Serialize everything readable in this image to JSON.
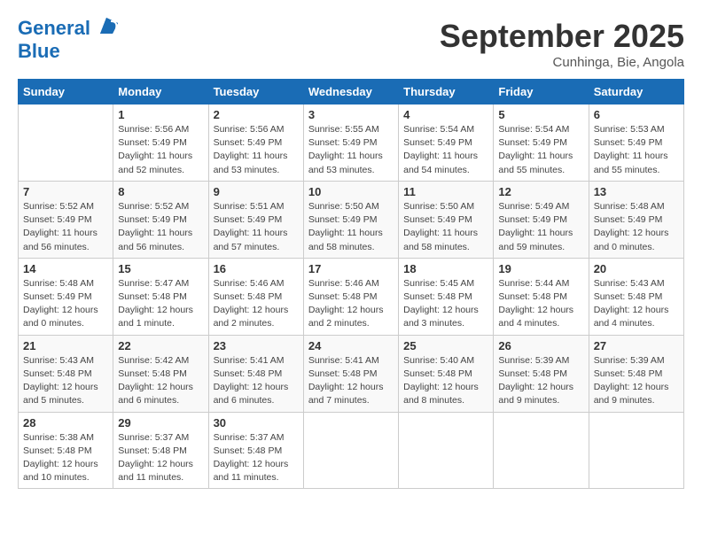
{
  "header": {
    "logo_line1": "General",
    "logo_line2": "Blue",
    "month": "September 2025",
    "location": "Cunhinga, Bie, Angola"
  },
  "days_of_week": [
    "Sunday",
    "Monday",
    "Tuesday",
    "Wednesday",
    "Thursday",
    "Friday",
    "Saturday"
  ],
  "weeks": [
    [
      {
        "day": "",
        "info": ""
      },
      {
        "day": "1",
        "info": "Sunrise: 5:56 AM\nSunset: 5:49 PM\nDaylight: 11 hours\nand 52 minutes."
      },
      {
        "day": "2",
        "info": "Sunrise: 5:56 AM\nSunset: 5:49 PM\nDaylight: 11 hours\nand 53 minutes."
      },
      {
        "day": "3",
        "info": "Sunrise: 5:55 AM\nSunset: 5:49 PM\nDaylight: 11 hours\nand 53 minutes."
      },
      {
        "day": "4",
        "info": "Sunrise: 5:54 AM\nSunset: 5:49 PM\nDaylight: 11 hours\nand 54 minutes."
      },
      {
        "day": "5",
        "info": "Sunrise: 5:54 AM\nSunset: 5:49 PM\nDaylight: 11 hours\nand 55 minutes."
      },
      {
        "day": "6",
        "info": "Sunrise: 5:53 AM\nSunset: 5:49 PM\nDaylight: 11 hours\nand 55 minutes."
      }
    ],
    [
      {
        "day": "7",
        "info": "Sunrise: 5:52 AM\nSunset: 5:49 PM\nDaylight: 11 hours\nand 56 minutes."
      },
      {
        "day": "8",
        "info": "Sunrise: 5:52 AM\nSunset: 5:49 PM\nDaylight: 11 hours\nand 56 minutes."
      },
      {
        "day": "9",
        "info": "Sunrise: 5:51 AM\nSunset: 5:49 PM\nDaylight: 11 hours\nand 57 minutes."
      },
      {
        "day": "10",
        "info": "Sunrise: 5:50 AM\nSunset: 5:49 PM\nDaylight: 11 hours\nand 58 minutes."
      },
      {
        "day": "11",
        "info": "Sunrise: 5:50 AM\nSunset: 5:49 PM\nDaylight: 11 hours\nand 58 minutes."
      },
      {
        "day": "12",
        "info": "Sunrise: 5:49 AM\nSunset: 5:49 PM\nDaylight: 11 hours\nand 59 minutes."
      },
      {
        "day": "13",
        "info": "Sunrise: 5:48 AM\nSunset: 5:49 PM\nDaylight: 12 hours\nand 0 minutes."
      }
    ],
    [
      {
        "day": "14",
        "info": "Sunrise: 5:48 AM\nSunset: 5:49 PM\nDaylight: 12 hours\nand 0 minutes."
      },
      {
        "day": "15",
        "info": "Sunrise: 5:47 AM\nSunset: 5:48 PM\nDaylight: 12 hours\nand 1 minute."
      },
      {
        "day": "16",
        "info": "Sunrise: 5:46 AM\nSunset: 5:48 PM\nDaylight: 12 hours\nand 2 minutes."
      },
      {
        "day": "17",
        "info": "Sunrise: 5:46 AM\nSunset: 5:48 PM\nDaylight: 12 hours\nand 2 minutes."
      },
      {
        "day": "18",
        "info": "Sunrise: 5:45 AM\nSunset: 5:48 PM\nDaylight: 12 hours\nand 3 minutes."
      },
      {
        "day": "19",
        "info": "Sunrise: 5:44 AM\nSunset: 5:48 PM\nDaylight: 12 hours\nand 4 minutes."
      },
      {
        "day": "20",
        "info": "Sunrise: 5:43 AM\nSunset: 5:48 PM\nDaylight: 12 hours\nand 4 minutes."
      }
    ],
    [
      {
        "day": "21",
        "info": "Sunrise: 5:43 AM\nSunset: 5:48 PM\nDaylight: 12 hours\nand 5 minutes."
      },
      {
        "day": "22",
        "info": "Sunrise: 5:42 AM\nSunset: 5:48 PM\nDaylight: 12 hours\nand 6 minutes."
      },
      {
        "day": "23",
        "info": "Sunrise: 5:41 AM\nSunset: 5:48 PM\nDaylight: 12 hours\nand 6 minutes."
      },
      {
        "day": "24",
        "info": "Sunrise: 5:41 AM\nSunset: 5:48 PM\nDaylight: 12 hours\nand 7 minutes."
      },
      {
        "day": "25",
        "info": "Sunrise: 5:40 AM\nSunset: 5:48 PM\nDaylight: 12 hours\nand 8 minutes."
      },
      {
        "day": "26",
        "info": "Sunrise: 5:39 AM\nSunset: 5:48 PM\nDaylight: 12 hours\nand 9 minutes."
      },
      {
        "day": "27",
        "info": "Sunrise: 5:39 AM\nSunset: 5:48 PM\nDaylight: 12 hours\nand 9 minutes."
      }
    ],
    [
      {
        "day": "28",
        "info": "Sunrise: 5:38 AM\nSunset: 5:48 PM\nDaylight: 12 hours\nand 10 minutes."
      },
      {
        "day": "29",
        "info": "Sunrise: 5:37 AM\nSunset: 5:48 PM\nDaylight: 12 hours\nand 11 minutes."
      },
      {
        "day": "30",
        "info": "Sunrise: 5:37 AM\nSunset: 5:48 PM\nDaylight: 12 hours\nand 11 minutes."
      },
      {
        "day": "",
        "info": ""
      },
      {
        "day": "",
        "info": ""
      },
      {
        "day": "",
        "info": ""
      },
      {
        "day": "",
        "info": ""
      }
    ]
  ]
}
